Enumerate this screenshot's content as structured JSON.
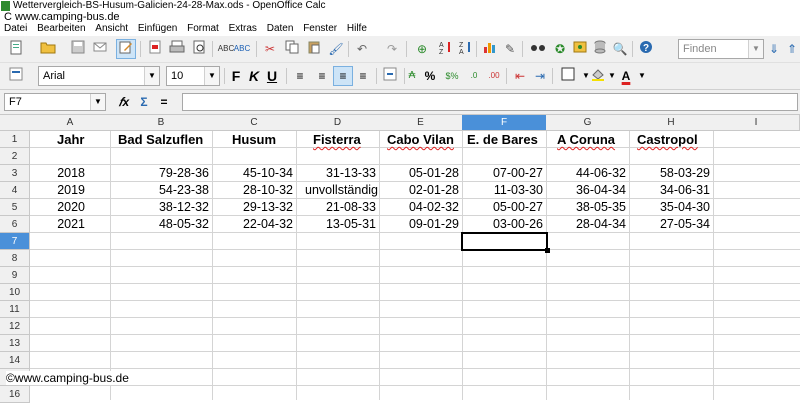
{
  "window": {
    "title": "Wettervergleich-BS-Husum-Galicien-24-28-Max.ods - OpenOffice Calc",
    "watermark_top": "C www.camping-bus.de",
    "watermark_bottom": "©www.camping-bus.de"
  },
  "menu": [
    "Datei",
    "Bearbeiten",
    "Ansicht",
    "Einfügen",
    "Format",
    "Extras",
    "Daten",
    "Fenster",
    "Hilfe"
  ],
  "toolbar": {
    "find_placeholder": "Finden",
    "font_name": "Arial",
    "font_size": "10"
  },
  "formula_bar": {
    "name_box": "F7",
    "content": ""
  },
  "sheet": {
    "columns": [
      "A",
      "B",
      "C",
      "D",
      "E",
      "F",
      "G",
      "H",
      "I"
    ],
    "selected_column": "F",
    "selected_row": "7",
    "active_cell": "F7",
    "rows": [
      "1",
      "2",
      "3",
      "4",
      "5",
      "6",
      "7",
      "8",
      "9",
      "10",
      "11",
      "12",
      "13",
      "14",
      "15",
      "16"
    ],
    "headers": [
      "Jahr",
      "Bad Salzuflen",
      "Husum",
      "Fisterra",
      "Cabo Vilan",
      "E. de Bares",
      "A Coruna",
      "Castropol"
    ],
    "data": [
      [
        "2018",
        "79-28-36",
        "45-10-34",
        "31-13-33",
        "05-01-28",
        "07-00-27",
        "44-06-32",
        "58-03-29"
      ],
      [
        "2019",
        "54-23-38",
        "28-10-32",
        "unvollständig",
        "02-01-28",
        "11-03-30",
        "36-04-34",
        "34-06-31"
      ],
      [
        "2020",
        "38-12-32",
        "29-13-32",
        "21-08-33",
        "04-02-32",
        "05-00-27",
        "38-05-35",
        "35-04-30"
      ],
      [
        "2021",
        "48-05-32",
        "22-04-32",
        "13-05-31",
        "09-01-29",
        "03-00-26",
        "28-04-34",
        "27-05-34"
      ]
    ]
  }
}
